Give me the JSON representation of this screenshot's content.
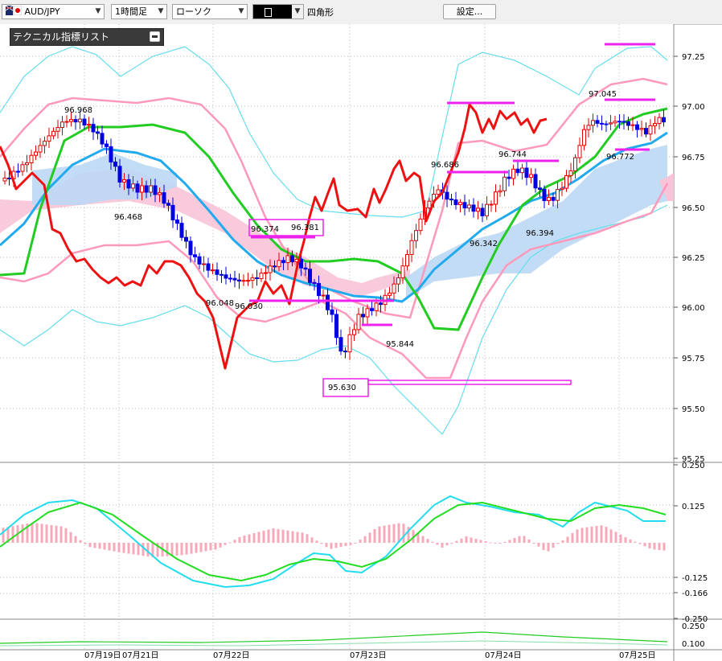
{
  "toolbar": {
    "symbol": "AUD/JPY",
    "timeframe": "1時間足",
    "chart_type": "ローソク",
    "draw_tool": "四角形",
    "settings_label": "設定..."
  },
  "indicator_panel": {
    "label": "テクニカル指標リスト"
  },
  "price_axis": [
    "97.25",
    "97.00",
    "96.75",
    "96.50",
    "96.25",
    "96.00",
    "95.75",
    "95.50",
    "95.25"
  ],
  "macd_axis": [
    "0.250",
    "0.125",
    "-0.125",
    "-0.166",
    "-0.250"
  ],
  "lower_axis": [
    "0.250",
    "0.100"
  ],
  "date_axis": [
    "07月19日",
    "07月21日",
    "07月22日",
    "07月23日",
    "07月24日",
    "07月25日"
  ],
  "price_annotations": [
    "96.968",
    "96.468",
    "96.048",
    "96.030",
    "96.374",
    "96.381",
    "95.630",
    "95.844",
    "96.686",
    "96.342",
    "96.744",
    "96.394",
    "97.045",
    "96.772"
  ],
  "colors": {
    "bull_candle": "#e00000",
    "bear_candle": "#0000e0",
    "chikou": "#ee1111",
    "bollinger_outer": "#66ddee",
    "bollinger_mid": "#ff99bb",
    "ma_fast": "#22cc22",
    "ma_mid": "#22aaee",
    "cloud_bull": "#bcd8f4",
    "cloud_bear": "#f8c4d8",
    "drawing": "#ee22ee"
  }
}
